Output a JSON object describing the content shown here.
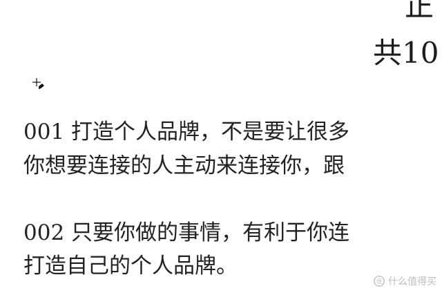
{
  "document": {
    "title_line_1": "正",
    "title_line_2": "共10",
    "paragraphs": [
      {
        "line_1": "001 打造个人品牌，不是要让很多",
        "line_2": "你想要连接的人主动来连接你，跟"
      },
      {
        "line_1": "002 只要你做的事情，有利于你连",
        "line_2": "打造自己的个人品牌。"
      }
    ]
  },
  "watermark": {
    "icon": "zhihu-style-value-icon",
    "text": "什么值得买"
  },
  "cursor": {
    "icon": "crosshair-pencil-cursor-icon"
  },
  "colors": {
    "text": "#222222",
    "watermark": "#bdbdbd",
    "background": "#ffffff"
  }
}
